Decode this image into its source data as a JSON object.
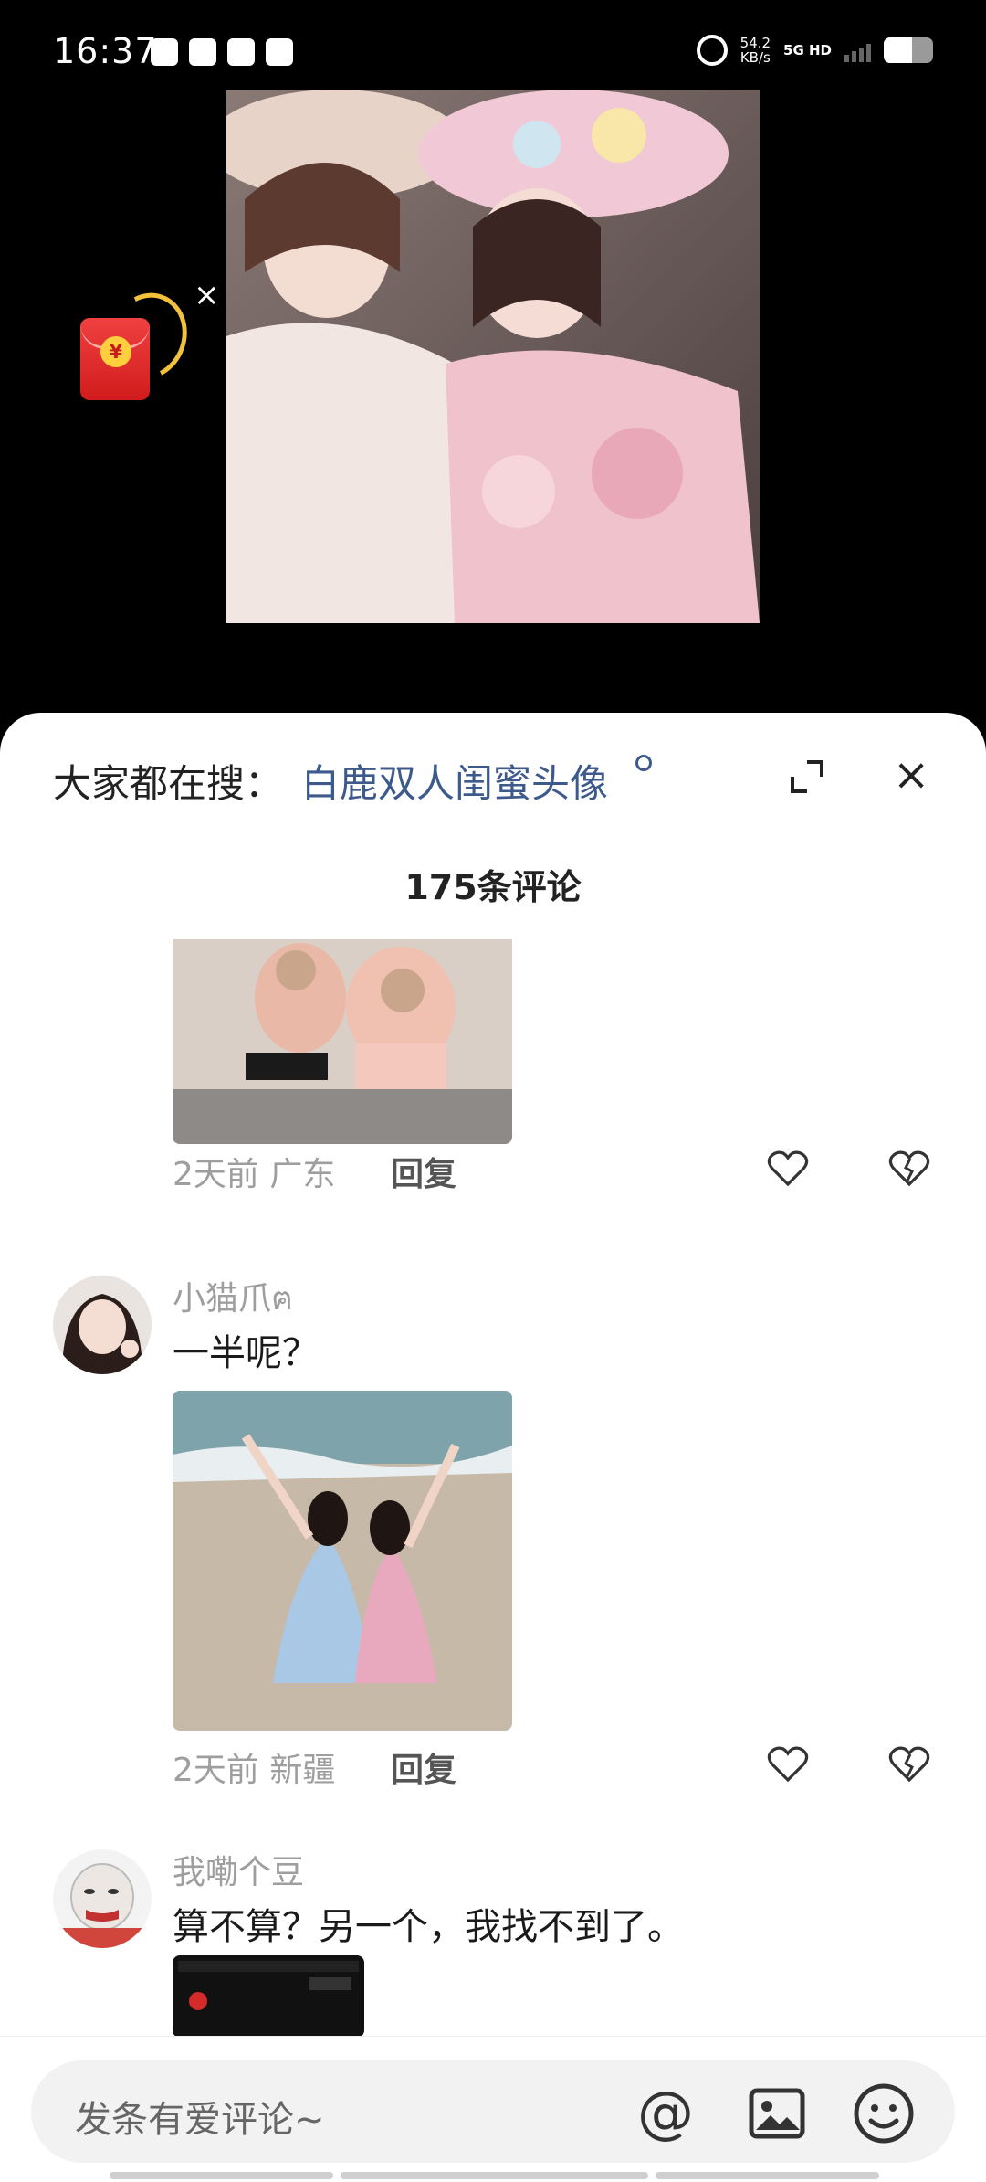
{
  "status_bar": {
    "time": "16:37",
    "net_speed_value": "54.2",
    "net_speed_unit": "KB/s",
    "network_type": "5G HD"
  },
  "sheet": {
    "search_prefix": "大家都在搜：",
    "search_keyword": "白鹿双人闺蜜头像",
    "comment_count": "175条评论"
  },
  "comments": [
    {
      "meta": "2天前 广东",
      "reply": "回复"
    },
    {
      "nickname": "小猫爪ฅ",
      "text": "一半呢？",
      "meta": "2天前 新疆",
      "reply": "回复"
    },
    {
      "nickname": "我嘞个豆",
      "text": "算不算？另一个，我找不到了。"
    }
  ],
  "input_bar": {
    "placeholder": "发条有爱评论~",
    "at_symbol": "@"
  },
  "icons": {
    "red_envelope_symbol": "¥",
    "close_symbol": "×"
  }
}
